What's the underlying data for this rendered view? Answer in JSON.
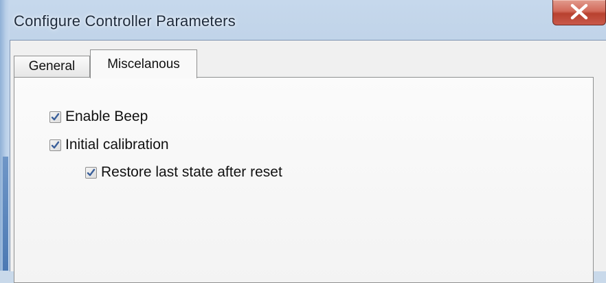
{
  "window": {
    "title": "Configure Controller Parameters"
  },
  "tabs": [
    {
      "label": "General",
      "selected": false
    },
    {
      "label": "Miscelanous",
      "selected": true
    }
  ],
  "options": [
    {
      "label": "Enable Beep",
      "checked": true
    },
    {
      "label": "Initial calibration",
      "checked": true
    },
    {
      "label": "Restore last state after reset",
      "checked": true
    }
  ],
  "colors": {
    "close_button": "#c9594a",
    "checkmark": "#3a5f9a"
  }
}
